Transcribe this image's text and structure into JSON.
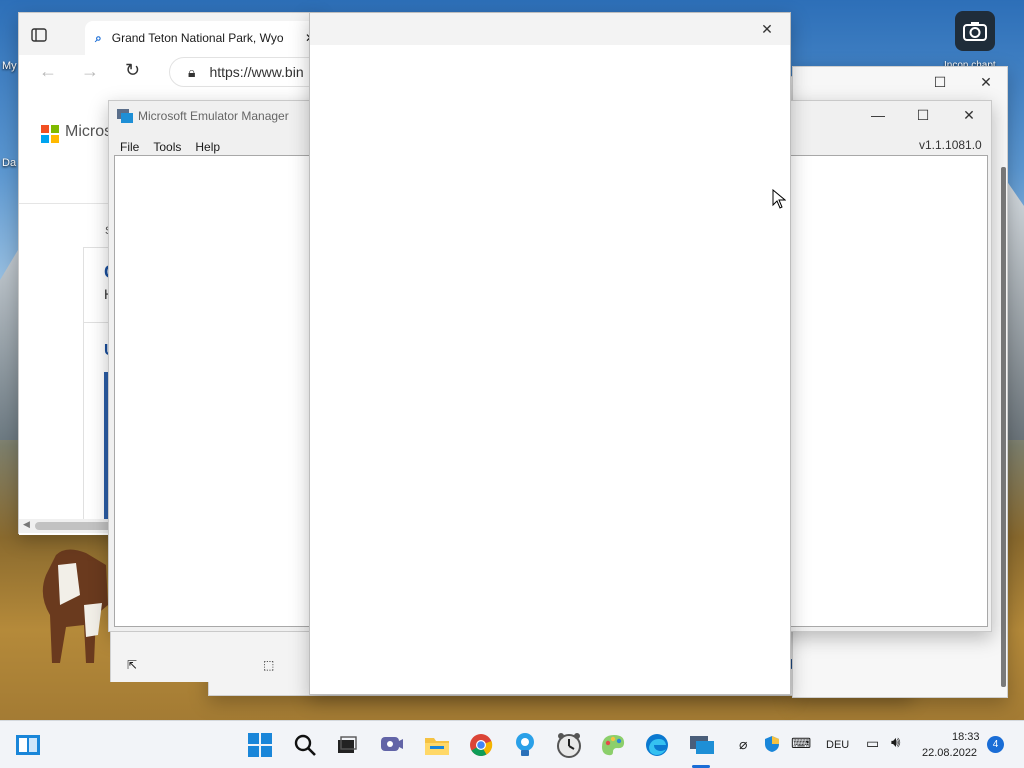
{
  "desktop": {
    "icons": [
      {
        "label": "My"
      },
      {
        "label": "Da"
      },
      {
        "label": "Incon chapt"
      }
    ]
  },
  "browser": {
    "tab_title": "Grand Teton National Park, Wyo",
    "address": "https://www.bin",
    "page_logo_text": "Micros",
    "page_letters": [
      "S",
      "C",
      "H",
      "U"
    ]
  },
  "emulator": {
    "title": "Microsoft Emulator Manager",
    "menu": [
      "File",
      "Tools",
      "Help"
    ],
    "version": "v1.1.1081.0"
  },
  "blank_dialog": {
    "close_label": "✕"
  },
  "taskbar": {
    "language": "DEU",
    "time": "18:33",
    "date": "22.08.2022",
    "notification_count": "4"
  }
}
